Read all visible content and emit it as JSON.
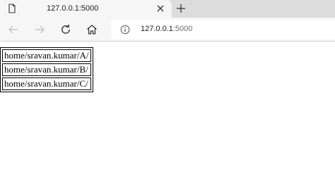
{
  "browser": {
    "tab": {
      "title": "127.0.0.1:5000",
      "favicon_icon": "page-icon",
      "close_icon": "close-icon"
    },
    "new_tab_icon": "plus-icon",
    "nav": {
      "back_icon": "arrow-left-icon",
      "forward_icon": "arrow-right-icon",
      "reload_icon": "reload-icon",
      "home_icon": "home-icon"
    },
    "address": {
      "info_icon": "info-icon",
      "host": "127.0.0.1",
      "port": ":5000"
    }
  },
  "page": {
    "rows": [
      {
        "path": "home/sravan.kumar/A/"
      },
      {
        "path": "home/sravan.kumar/B/"
      },
      {
        "path": "home/sravan.kumar/C/"
      }
    ]
  }
}
